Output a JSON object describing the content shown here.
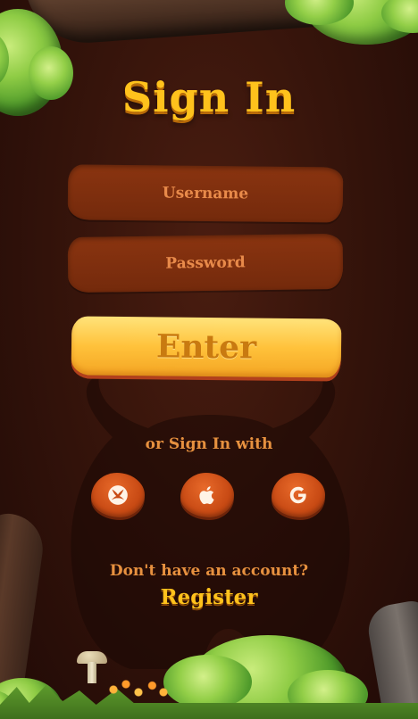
{
  "screen": {
    "title": "Sign In",
    "username_placeholder": "Username",
    "password_placeholder": "Password",
    "enter_label": "Enter",
    "alt_signin_text": "or Sign In with",
    "social": [
      {
        "name": "Xbox",
        "icon": "xbox-icon"
      },
      {
        "name": "Apple",
        "icon": "apple-icon"
      },
      {
        "name": "Google",
        "icon": "google-icon"
      }
    ],
    "no_account_text": "Don't have an account?",
    "register_label": "Register"
  },
  "colors": {
    "background": "#36140b",
    "title": "#ffc21c",
    "field": "#8a3410",
    "field_text": "#e88a4a",
    "button": "#ffc23b",
    "button_text": "#c97a10",
    "social_button": "#c84a14",
    "accent_text": "#e7913f"
  }
}
